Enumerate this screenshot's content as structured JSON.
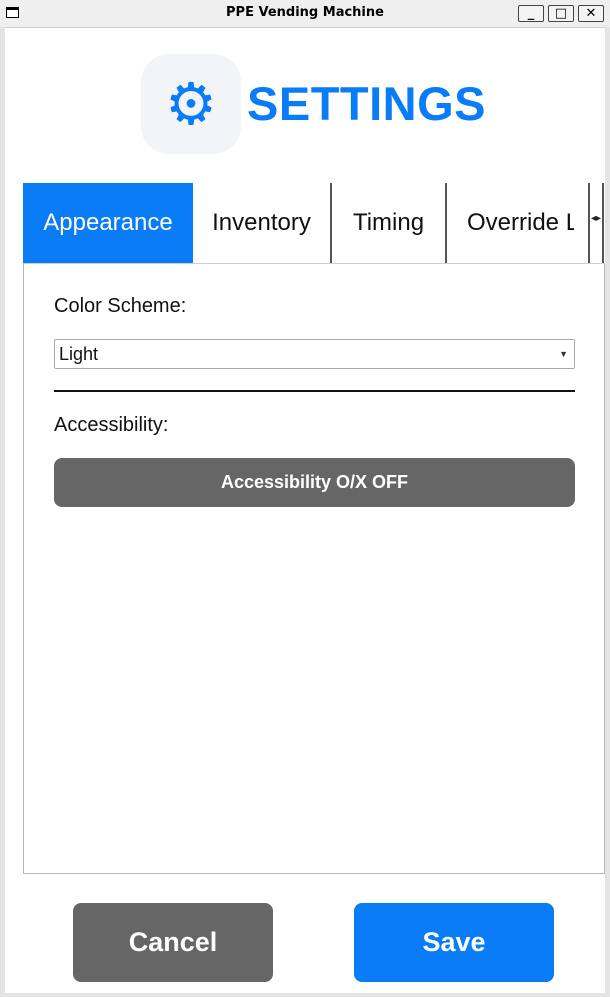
{
  "window": {
    "title": "PPE Vending Machine",
    "minimize": "_",
    "maximize": "□",
    "close": "✕"
  },
  "header": {
    "icon": "gear-icon",
    "icon_glyph": "⚙",
    "title": "SETTINGS"
  },
  "tabs": [
    {
      "label": "Appearance",
      "active": true
    },
    {
      "label": "Inventory",
      "active": false
    },
    {
      "label": "Timing",
      "active": false
    },
    {
      "label": "Override L",
      "active": false
    }
  ],
  "tab_scroll": {
    "left": "◂",
    "right": "▸"
  },
  "appearance": {
    "color_scheme_label": "Color Scheme:",
    "color_scheme_value": "Light",
    "accessibility_label": "Accessibility:",
    "accessibility_button": "Accessibility O/X OFF"
  },
  "footer": {
    "cancel_label": "Cancel",
    "save_label": "Save"
  },
  "colors": {
    "accent": "#0a7cf7",
    "neutral_button": "#666666"
  }
}
